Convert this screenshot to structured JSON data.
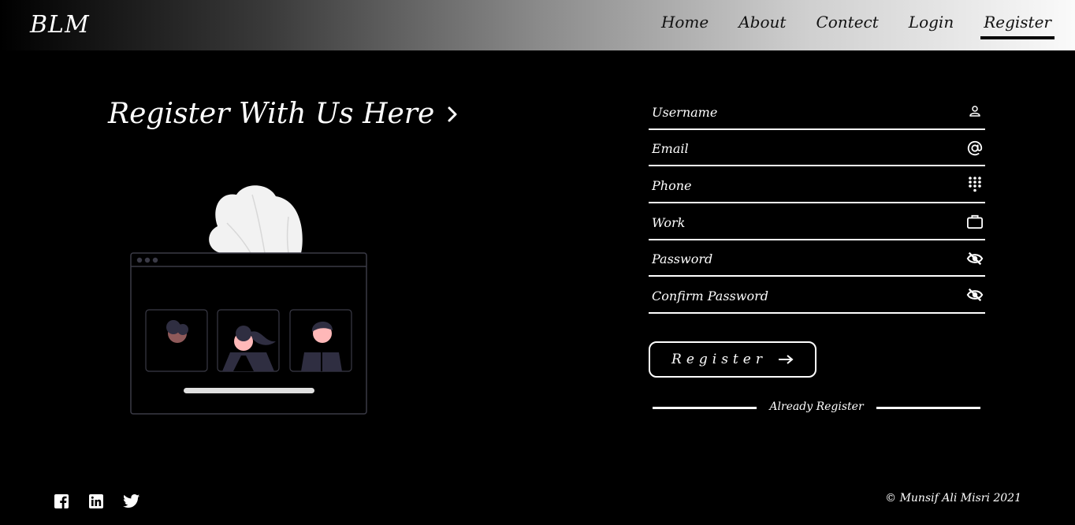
{
  "header": {
    "brand": "BLM",
    "nav": [
      {
        "label": "Home"
      },
      {
        "label": "About"
      },
      {
        "label": "Contect"
      },
      {
        "label": "Login"
      },
      {
        "label": "Register",
        "active": true
      }
    ]
  },
  "main": {
    "title": "Register With Us Here"
  },
  "form": {
    "fields": [
      {
        "placeholder": "Username",
        "value": "",
        "icon": "user-icon"
      },
      {
        "placeholder": "Email",
        "value": "",
        "icon": "at-sign-icon"
      },
      {
        "placeholder": "Phone",
        "value": "",
        "icon": "dialpad-icon"
      },
      {
        "placeholder": "Work",
        "value": "",
        "icon": "briefcase-icon"
      },
      {
        "placeholder": "Password",
        "value": "",
        "icon": "eye-off-icon"
      },
      {
        "placeholder": "Confirm Password",
        "value": "",
        "icon": "eye-off-icon"
      }
    ],
    "submit_label": "Register",
    "already_label": "Already Register"
  },
  "footer": {
    "social": [
      "facebook-icon",
      "linkedin-icon",
      "twitter-icon"
    ],
    "copyright": "© Munsif Ali Misri 2021"
  },
  "colors": {
    "background": "#000000",
    "text": "#ffffff",
    "header_gradient_start": "#000000",
    "header_gradient_end": "#fafafa"
  }
}
